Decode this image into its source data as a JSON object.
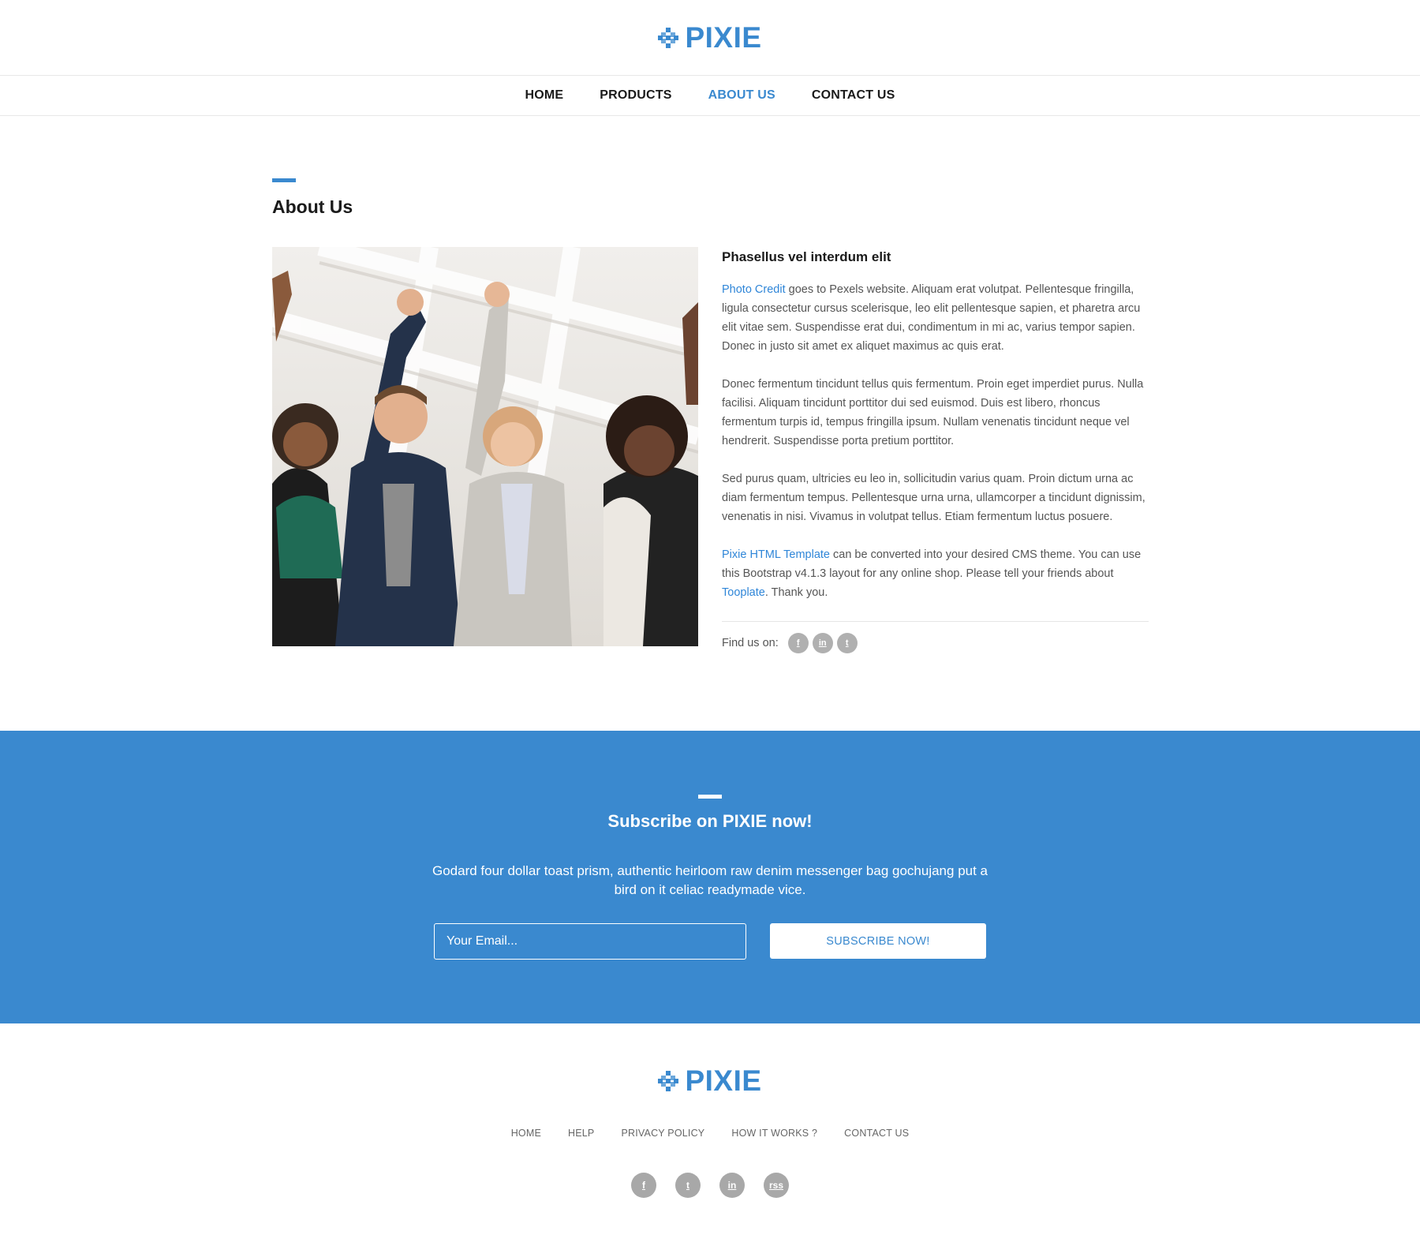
{
  "brand": {
    "name": "PIXIE",
    "color": "#3a89cf"
  },
  "nav": {
    "items": [
      {
        "label": "HOME",
        "active": false
      },
      {
        "label": "PRODUCTS",
        "active": false
      },
      {
        "label": "ABOUT US",
        "active": true
      },
      {
        "label": "CONTACT US",
        "active": false
      }
    ]
  },
  "about": {
    "title": "About Us",
    "subtitle": "Phasellus vel interdum elit",
    "p1_link": "Photo Credit",
    "p1_text": " goes to Pexels website. Aliquam erat volutpat. Pellentesque fringilla, ligula consectetur cursus scelerisque, leo elit pellentesque sapien, et pharetra arcu elit vitae sem. Suspendisse erat dui, condimentum in mi ac, varius tempor sapien. Donec in justo sit amet ex aliquet maximus ac quis erat.",
    "p2": "Donec fermentum tincidunt tellus quis fermentum. Proin eget imperdiet purus. Nulla facilisi. Aliquam tincidunt porttitor dui sed euismod. Duis est libero, rhoncus fermentum turpis id, tempus fringilla ipsum. Nullam venenatis tincidunt neque vel hendrerit. Suspendisse porta pretium porttitor.",
    "p3": "Sed purus quam, ultricies eu leo in, sollicitudin varius quam. Proin dictum urna ac diam fermentum tempus. Pellentesque urna urna, ullamcorper a tincidunt dignissim, venenatis in nisi. Vivamus in volutpat tellus. Etiam fermentum luctus posuere.",
    "p4_link1": "Pixie HTML Template",
    "p4_text1": " can be converted into your desired CMS theme. You can use this Bootstrap v4.1.3 layout for any online shop. Please tell your friends about ",
    "p4_link2": "Tooplate",
    "p4_text2": ". Thank you.",
    "find_label": "Find us on:",
    "social": [
      {
        "icon": "facebook-icon",
        "glyph": "f"
      },
      {
        "icon": "linkedin-icon",
        "glyph": "in"
      },
      {
        "icon": "twitter-icon",
        "glyph": "t"
      }
    ]
  },
  "subscribe": {
    "heading": "Subscribe on PIXIE now!",
    "text": "Godard four dollar toast prism, authentic heirloom raw denim messenger bag gochujang put a bird on it celiac readymade vice.",
    "email_placeholder": "Your Email...",
    "button_label": "SUBSCRIBE NOW!",
    "background": "#3a89cf"
  },
  "footer": {
    "links": [
      "HOME",
      "HELP",
      "PRIVACY POLICY",
      "HOW IT WORKS ?",
      "CONTACT US"
    ],
    "social": [
      {
        "icon": "facebook-icon",
        "glyph": "f"
      },
      {
        "icon": "twitter-icon",
        "glyph": "t"
      },
      {
        "icon": "linkedin-icon",
        "glyph": "in"
      },
      {
        "icon": "rss-icon",
        "glyph": "rss"
      }
    ]
  }
}
